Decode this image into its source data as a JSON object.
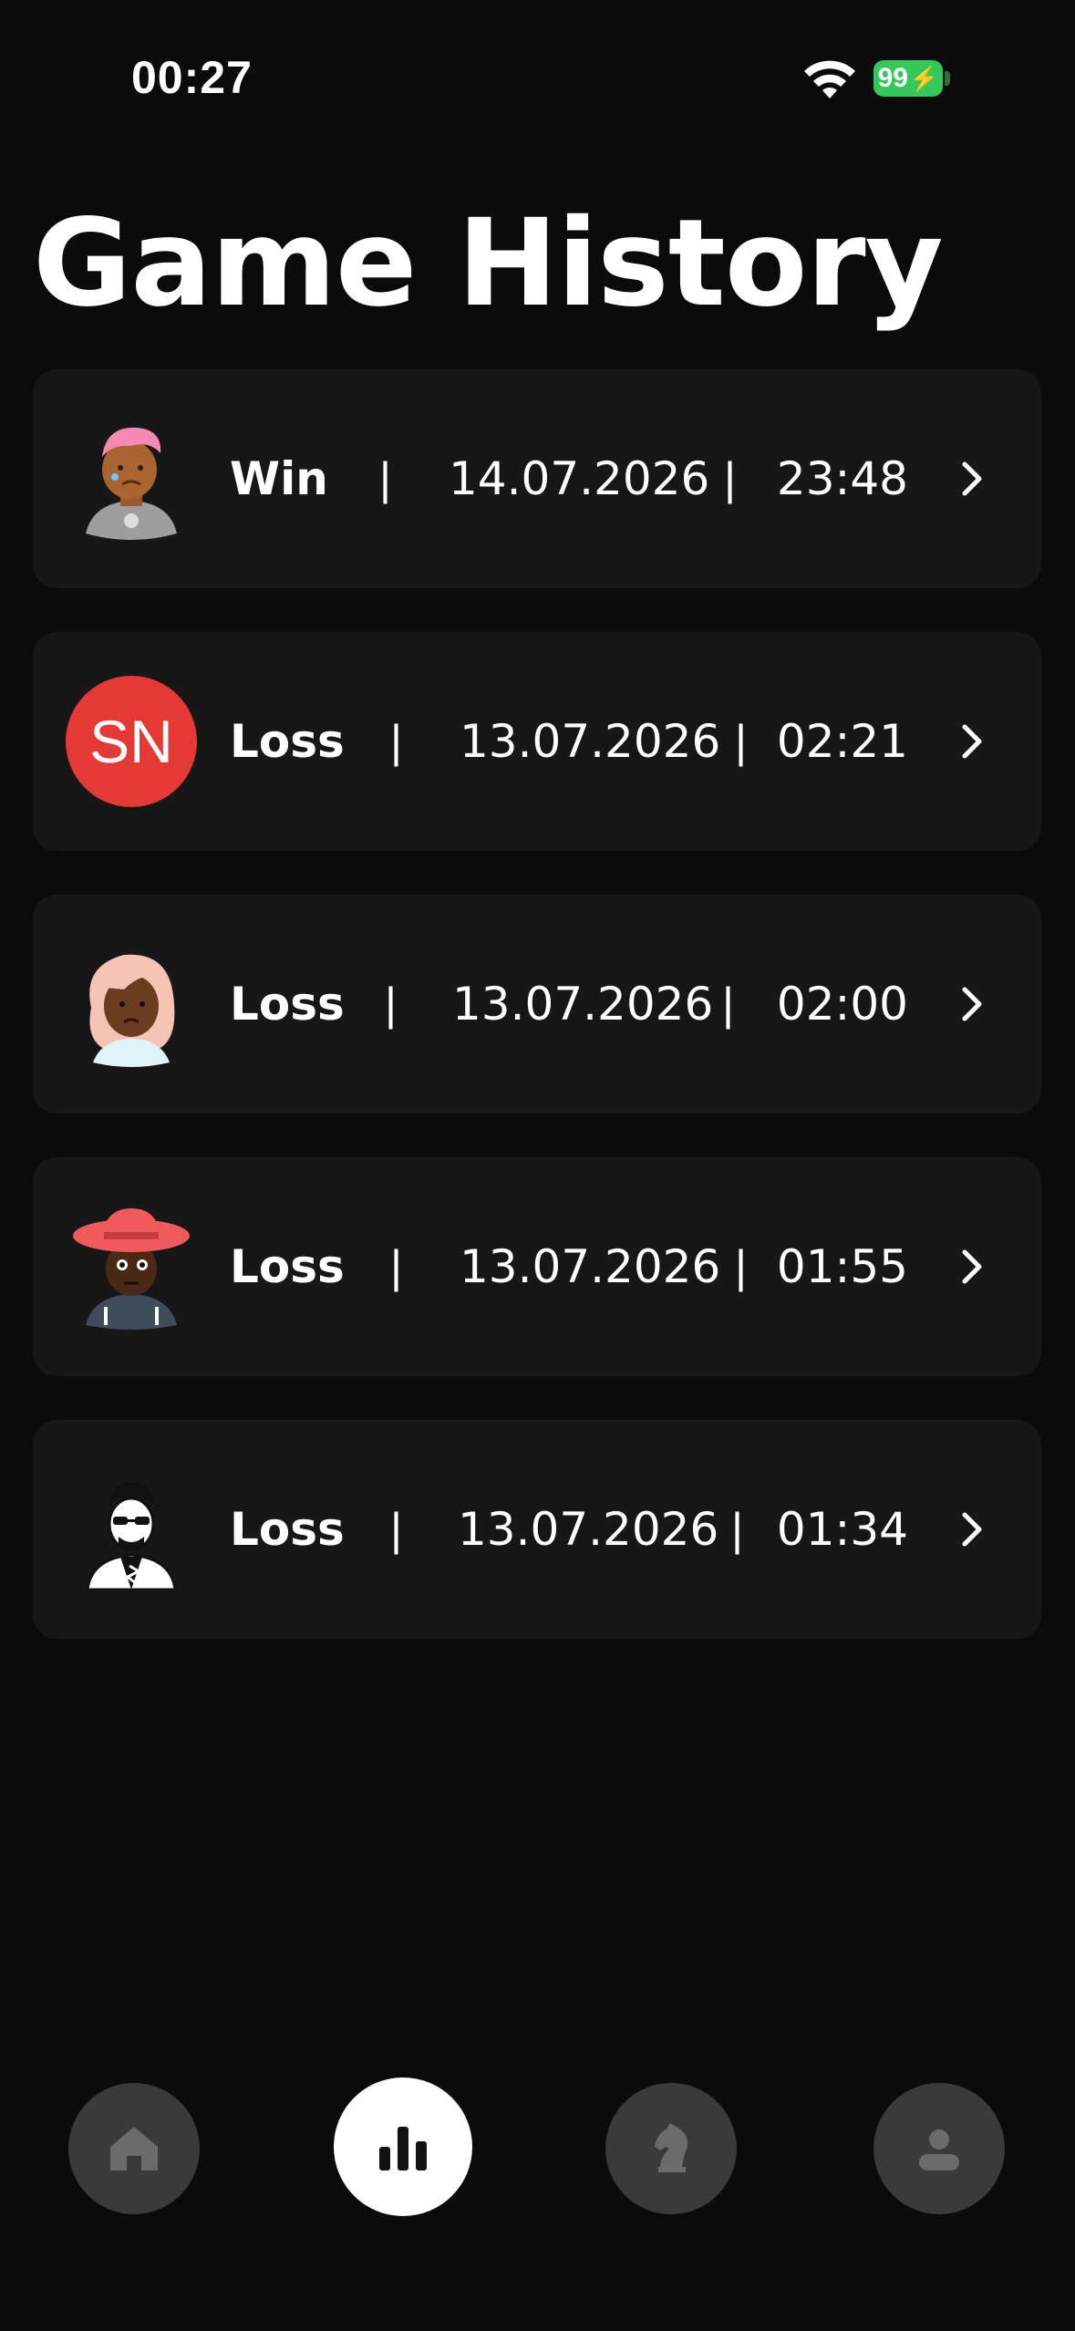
{
  "status_bar": {
    "time": "00:27",
    "battery": "99",
    "battery_color": "#34c759"
  },
  "header": {
    "title": "Game History"
  },
  "games": [
    {
      "avatar": "avatar-pink-hair-icon",
      "result": "Win",
      "date": "14.07.2026",
      "time": "23:48"
    },
    {
      "avatar": "initials",
      "initials": "SN",
      "initials_color": "#e53935",
      "result": "Loss",
      "date": "13.07.2026",
      "time": "02:21"
    },
    {
      "avatar": "avatar-long-hair-icon",
      "result": "Loss",
      "date": "13.07.2026",
      "time": "02:00"
    },
    {
      "avatar": "avatar-red-hat-icon",
      "result": "Loss",
      "date": "13.07.2026",
      "time": "01:55"
    },
    {
      "avatar": "avatar-sunglasses-icon",
      "result": "Loss",
      "date": "13.07.2026",
      "time": "01:34"
    }
  ],
  "separator": "|",
  "bottom_nav": {
    "items": [
      {
        "icon": "home-icon",
        "active": false
      },
      {
        "icon": "bar-chart-icon",
        "active": true
      },
      {
        "icon": "chess-knight-icon",
        "active": false
      },
      {
        "icon": "user-icon",
        "active": false
      }
    ],
    "active_color": "#ffffff",
    "inactive_color": "#3a3a3a"
  }
}
